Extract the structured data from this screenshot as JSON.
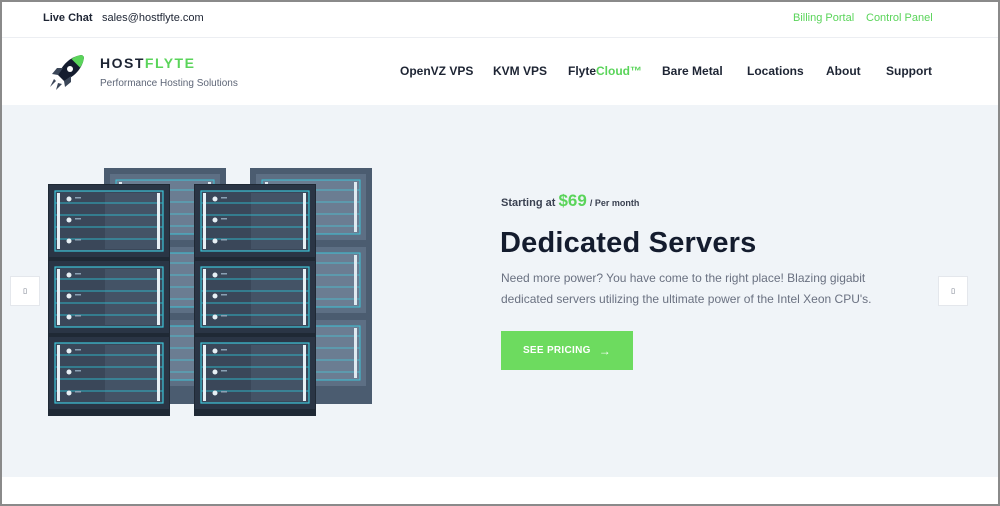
{
  "topbar": {
    "live_chat": "Live Chat",
    "email": "sales@hostflyte.com",
    "billing_portal": "Billing Portal",
    "control_panel": "Control Panel"
  },
  "header": {
    "brand_main": "HOST",
    "brand_accent": "FLYTE",
    "tagline": "Performance Hosting Solutions",
    "nav": [
      {
        "label": "OpenVZ VPS"
      },
      {
        "label": "KVM VPS"
      },
      {
        "label": "Flyte",
        "accent": "Cloud™"
      },
      {
        "label": "Bare Metal"
      },
      {
        "label": "Locations"
      },
      {
        "label": "About"
      },
      {
        "label": "Support"
      }
    ]
  },
  "hero": {
    "starting_prefix": "Starting at",
    "price": "$69",
    "per": "/ Per month",
    "title": "Dedicated Servers",
    "description": "Need more power? You have come to the right place! Blazing gigabit dedicated servers utilizing the ultimate power of the Intel Xeon CPU's.",
    "cta_label": "SEE PRICING",
    "cta_icon": "arrow-right-icon",
    "prev_icon": "slider-prev-icon",
    "next_icon": "slider-next-icon"
  },
  "colors": {
    "accent": "#5ad45a",
    "button": "#6ddb5f",
    "hero_bg": "#f0f4f8",
    "heading": "#141c2e"
  }
}
